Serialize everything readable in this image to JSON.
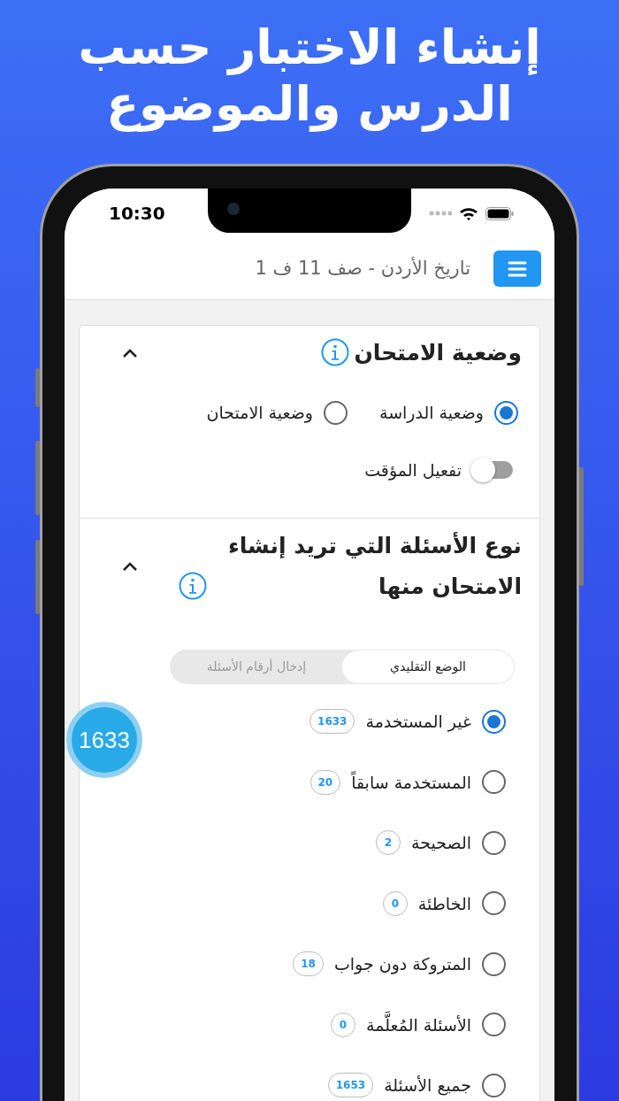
{
  "headline": [
    "إنشاء الاختبار حسب",
    "الدرس والموضوع"
  ],
  "status_bar": {
    "time": "10:30"
  },
  "app_bar": {
    "title": "تاريخ الأردن - صف 11 ف 1"
  },
  "sections": [
    {
      "title": "وضعية الامتحان",
      "expanded": true,
      "options": [
        {
          "label": "وضعية الدراسة",
          "selected": true
        },
        {
          "label": "وضعية الامتحان",
          "selected": false
        }
      ],
      "toggle": {
        "label": "تفعيل المؤقت",
        "on": false
      }
    },
    {
      "title": "نوع الأسئلة التي تريد إنشاء الامتحان منها",
      "expanded": true,
      "segments": [
        {
          "label": "الوضع التقليدي",
          "selected": true
        },
        {
          "label": "إدخال أرقام الأسئلة",
          "selected": false
        }
      ],
      "options": [
        {
          "label": "غير المستخدمة",
          "count": "1633",
          "selected": true
        },
        {
          "label": "المستخدمة سابقاً",
          "count": "20",
          "selected": false
        },
        {
          "label": "الصحيحة",
          "count": "2",
          "selected": false
        },
        {
          "label": "الخاطئة",
          "count": "0",
          "selected": false
        },
        {
          "label": "المتروكة دون جواب",
          "count": "18",
          "selected": false
        },
        {
          "label": "الأسئلة المُعلَّمة",
          "count": "0",
          "selected": false
        },
        {
          "label": "جميع الأسئلة",
          "count": "1653",
          "selected": false
        }
      ]
    }
  ],
  "floating_count": "1633"
}
